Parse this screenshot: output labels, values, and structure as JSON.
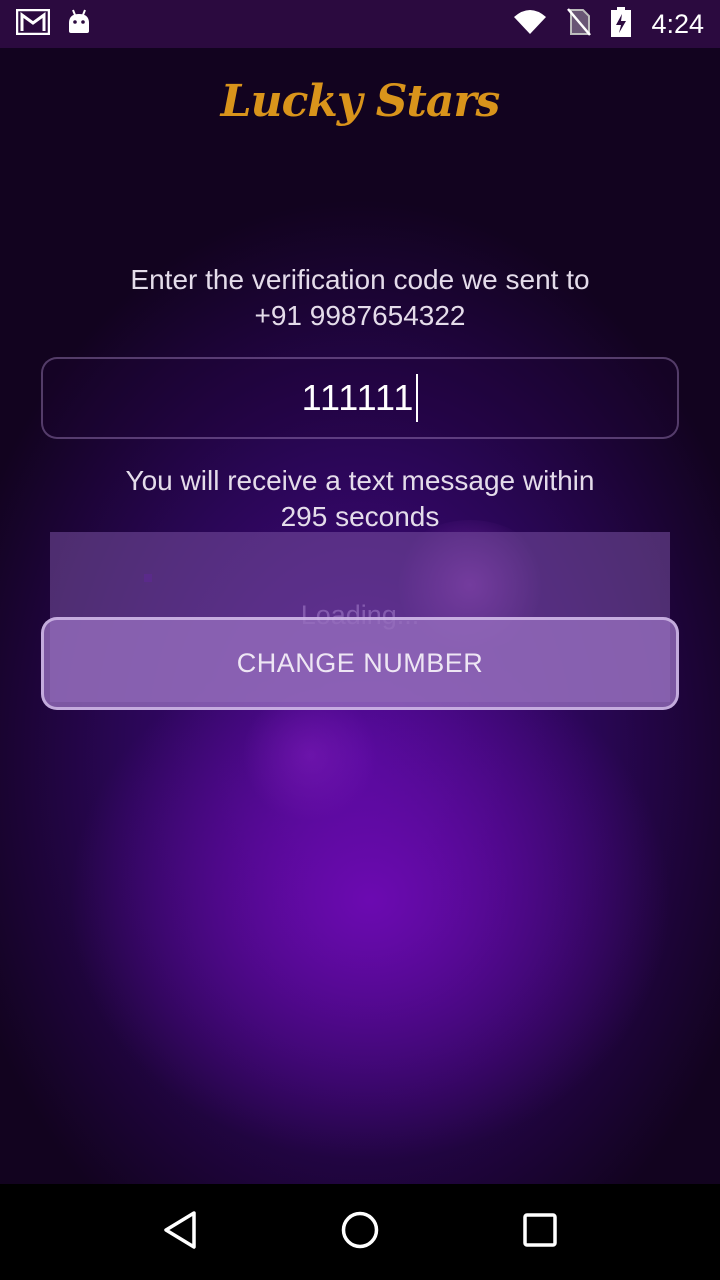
{
  "status_bar": {
    "time": "4:24",
    "icons": [
      "gmail-icon",
      "android-icon",
      "wifi-icon",
      "no-signal-icon",
      "battery-charging-icon"
    ]
  },
  "app": {
    "logo": "Lucky Stars"
  },
  "verification": {
    "prompt_line1": "Enter the verification code we sent to",
    "prompt_line2": "+91 9987654322",
    "code_value": "111111",
    "timer_line1": "You will receive a text message within",
    "timer_line2": "295 seconds"
  },
  "loading": {
    "text": "Loading..."
  },
  "actions": {
    "change_number": "CHANGE NUMBER"
  },
  "nav": {
    "icons": [
      "back-icon",
      "home-icon",
      "recents-icon"
    ]
  },
  "colors": {
    "logo": "#d9941b",
    "background": "#4b0a8f",
    "status_bar": "#2b0a3f"
  }
}
